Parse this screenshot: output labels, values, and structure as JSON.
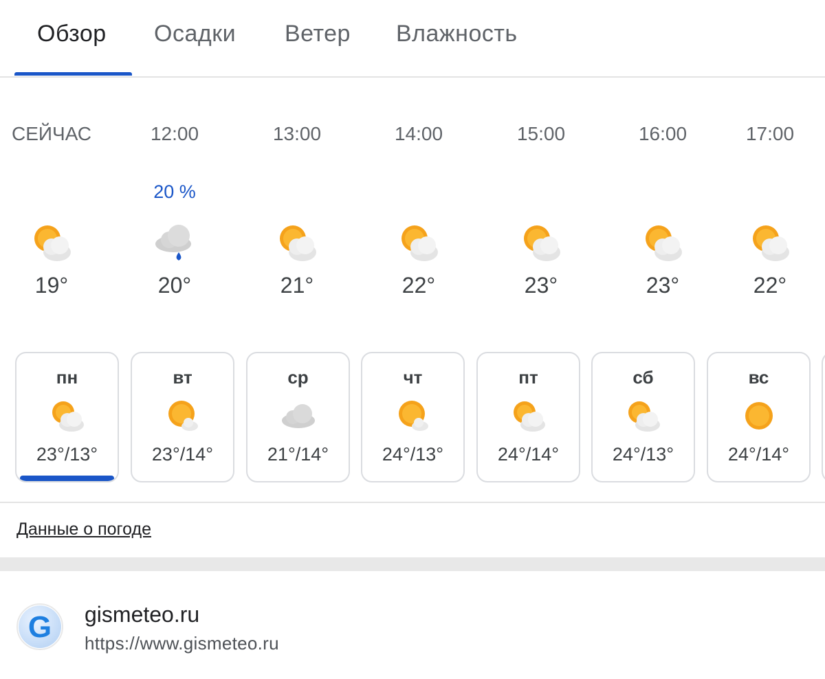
{
  "tabs": [
    {
      "label": "Обзор",
      "active": true
    },
    {
      "label": "Осадки",
      "active": false
    },
    {
      "label": "Ветер",
      "active": false
    },
    {
      "label": "Влажность",
      "active": false
    }
  ],
  "hourly": [
    {
      "time": "СЕЙЧАС",
      "precip": "",
      "icon": "sun-behind-cloud-icon",
      "temp": "19°"
    },
    {
      "time": "12:00",
      "precip": "20 %",
      "icon": "rain-cloud-icon",
      "temp": "20°"
    },
    {
      "time": "13:00",
      "precip": "",
      "icon": "sun-behind-cloud-icon",
      "temp": "21°"
    },
    {
      "time": "14:00",
      "precip": "",
      "icon": "sun-behind-cloud-icon",
      "temp": "22°"
    },
    {
      "time": "15:00",
      "precip": "",
      "icon": "sun-behind-cloud-icon",
      "temp": "23°"
    },
    {
      "time": "16:00",
      "precip": "",
      "icon": "sun-behind-cloud-icon",
      "temp": "23°"
    },
    {
      "time": "17:00",
      "precip": "",
      "icon": "sun-behind-cloud-icon",
      "temp": "22°"
    }
  ],
  "daily": [
    {
      "day": "пн",
      "icon": "sun-behind-cloud-icon",
      "range": "23°/13°",
      "selected": true
    },
    {
      "day": "вт",
      "icon": "sun-small-cloud-icon",
      "range": "23°/14°",
      "selected": false
    },
    {
      "day": "ср",
      "icon": "cloud-icon",
      "range": "21°/14°",
      "selected": false
    },
    {
      "day": "чт",
      "icon": "sun-small-cloud-icon",
      "range": "24°/13°",
      "selected": false
    },
    {
      "day": "пт",
      "icon": "sun-behind-cloud-icon",
      "range": "24°/14°",
      "selected": false
    },
    {
      "day": "сб",
      "icon": "sun-behind-cloud-icon",
      "range": "24°/13°",
      "selected": false
    },
    {
      "day": "вс",
      "icon": "sun-icon",
      "range": "24°/14°",
      "selected": false
    }
  ],
  "weather_data_link": "Данные о погоде",
  "source": {
    "name": "gismeteo.ru",
    "url": "https://www.gismeteo.ru",
    "logo_letter": "G"
  },
  "colors": {
    "accent": "#1a56c8",
    "sun": "#f5a21b",
    "cloud": "#e6e6e6"
  }
}
